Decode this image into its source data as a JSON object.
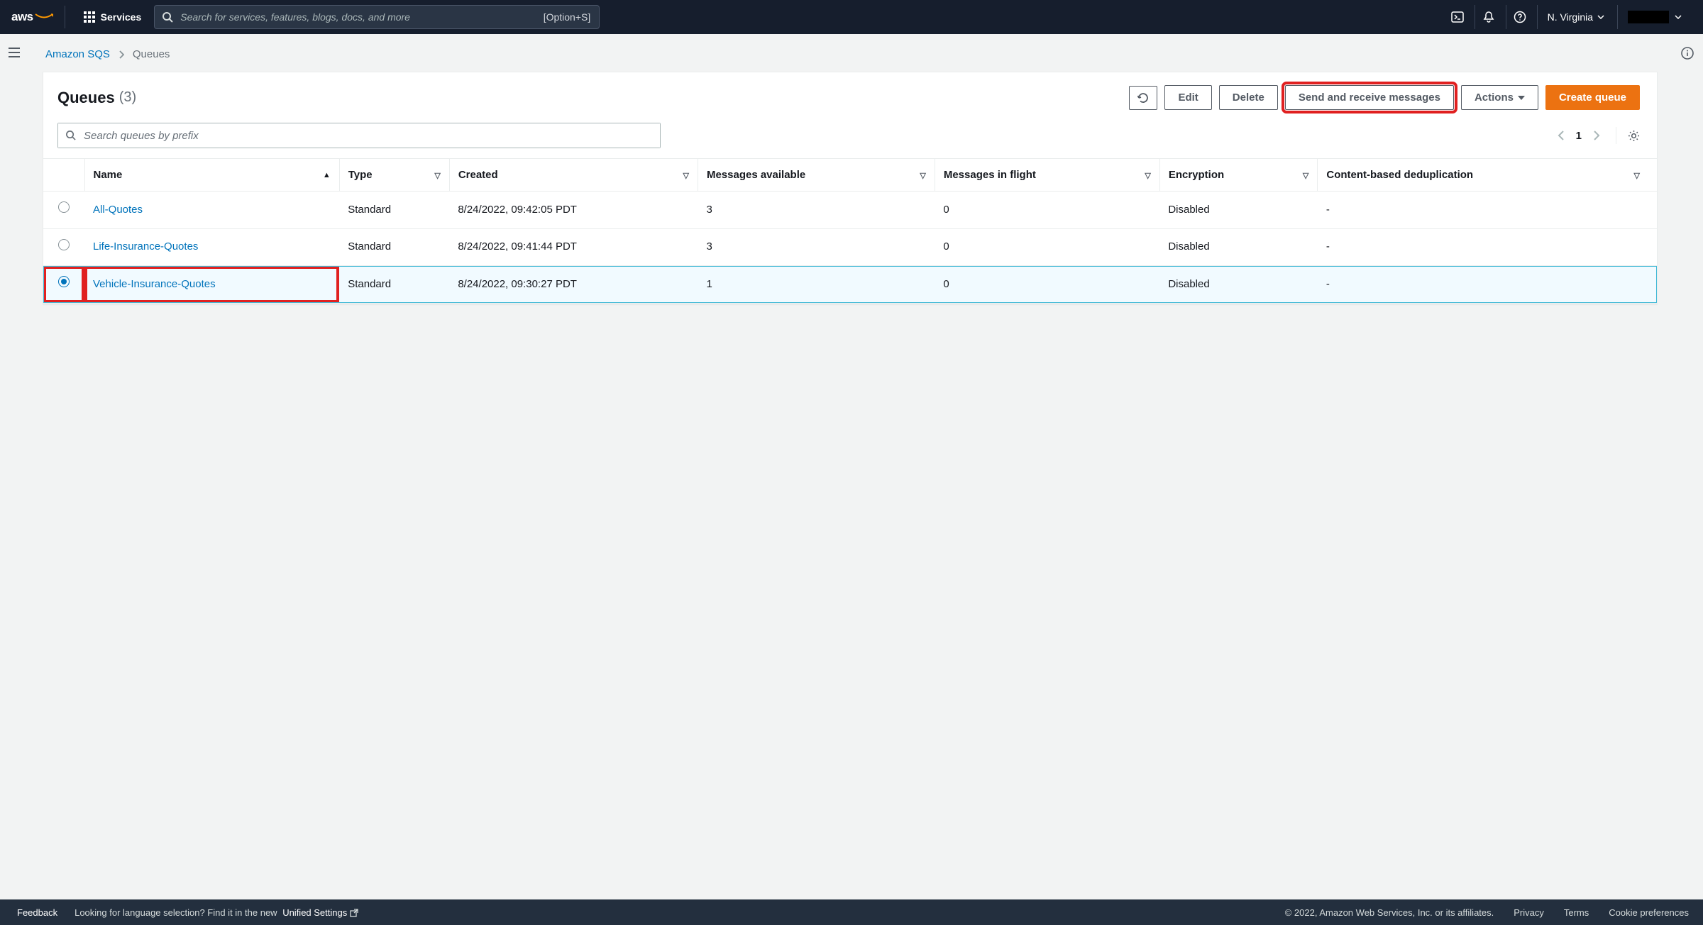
{
  "nav": {
    "services_label": "Services",
    "search_placeholder": "Search for services, features, blogs, docs, and more",
    "search_shortcut": "[Option+S]",
    "region": "N. Virginia"
  },
  "breadcrumbs": {
    "root": "Amazon SQS",
    "current": "Queues"
  },
  "panel": {
    "title": "Queues",
    "count": "(3)",
    "edit": "Edit",
    "delete": "Delete",
    "send_receive": "Send and receive messages",
    "actions": "Actions",
    "create": "Create queue",
    "search_placeholder": "Search queues by prefix",
    "page": "1"
  },
  "columns": {
    "name": "Name",
    "type": "Type",
    "created": "Created",
    "messages_available": "Messages available",
    "messages_in_flight": "Messages in flight",
    "encryption": "Encryption",
    "dedup": "Content-based deduplication"
  },
  "rows": [
    {
      "name": "All-Quotes",
      "type": "Standard",
      "created": "8/24/2022, 09:42:05 PDT",
      "avail": "3",
      "flight": "0",
      "enc": "Disabled",
      "dedup": "-",
      "selected": false,
      "highlight": false
    },
    {
      "name": "Life-Insurance-Quotes",
      "type": "Standard",
      "created": "8/24/2022, 09:41:44 PDT",
      "avail": "3",
      "flight": "0",
      "enc": "Disabled",
      "dedup": "-",
      "selected": false,
      "highlight": false
    },
    {
      "name": "Vehicle-Insurance-Quotes",
      "type": "Standard",
      "created": "8/24/2022, 09:30:27 PDT",
      "avail": "1",
      "flight": "0",
      "enc": "Disabled",
      "dedup": "-",
      "selected": true,
      "highlight": true
    }
  ],
  "footer": {
    "feedback": "Feedback",
    "lang_msg": "Looking for language selection? Find it in the new ",
    "unified": "Unified Settings",
    "copyright": "© 2022, Amazon Web Services, Inc. or its affiliates.",
    "privacy": "Privacy",
    "terms": "Terms",
    "cookies": "Cookie preferences"
  }
}
